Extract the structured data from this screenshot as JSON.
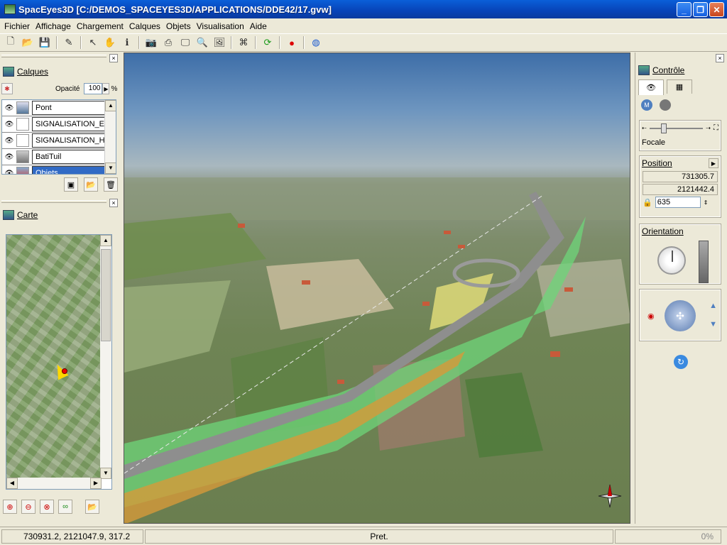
{
  "window": {
    "title": "SpacEyes3D [C:/DEMOS_SPACEYES3D/APPLICATIONS/DDE42/17.gvw]"
  },
  "menu": [
    "Fichier",
    "Affichage",
    "Chargement",
    "Calques",
    "Objets",
    "Visualisation",
    "Aide"
  ],
  "layers_panel": {
    "title": "Calques",
    "opacity_label": "Opacité",
    "opacity_value": "100",
    "opacity_unit": "%",
    "layers": [
      {
        "name": "Pont",
        "selected": false
      },
      {
        "name": "SIGNALISATION_EC",
        "selected": false
      },
      {
        "name": "SIGNALISATION_HO",
        "selected": false
      },
      {
        "name": "BatiTuil",
        "selected": false
      },
      {
        "name": "Objets",
        "selected": true
      }
    ]
  },
  "map_panel": {
    "title": "Carte"
  },
  "control_panel": {
    "title": "Contrôle",
    "focal_label": "Focale",
    "position_label": "Position",
    "position_x": "731305.7",
    "position_y": "2121442.4",
    "altitude": "635",
    "orientation_label": "Orientation"
  },
  "status": {
    "coords": "730931.2, 2121047.9, 317.2",
    "message": "Pret.",
    "progress": "0%"
  }
}
